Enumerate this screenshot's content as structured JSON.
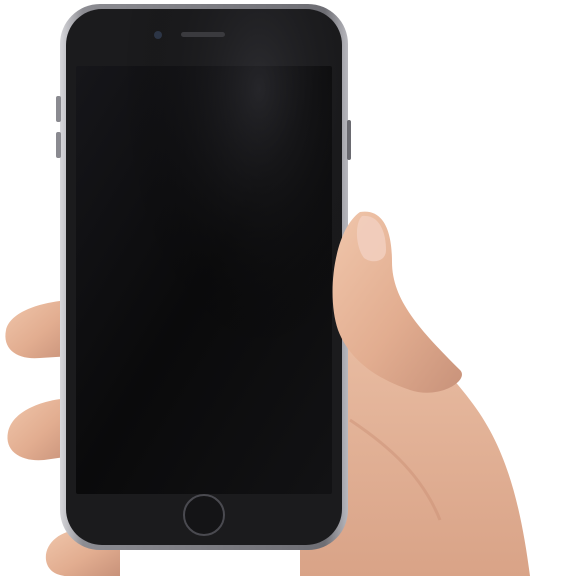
{
  "scene": {
    "subject": "hand-holding-smartphone",
    "background_color": "#ffffff",
    "colors": {
      "phone_frame": "#9a9a9e",
      "phone_body": "#1b1b1d",
      "screen": "#0b0b0c",
      "skin": "#e7b79a",
      "skin_shadow": "#c98f73",
      "nail": "#f3d2c4"
    },
    "screen_state": "off"
  }
}
